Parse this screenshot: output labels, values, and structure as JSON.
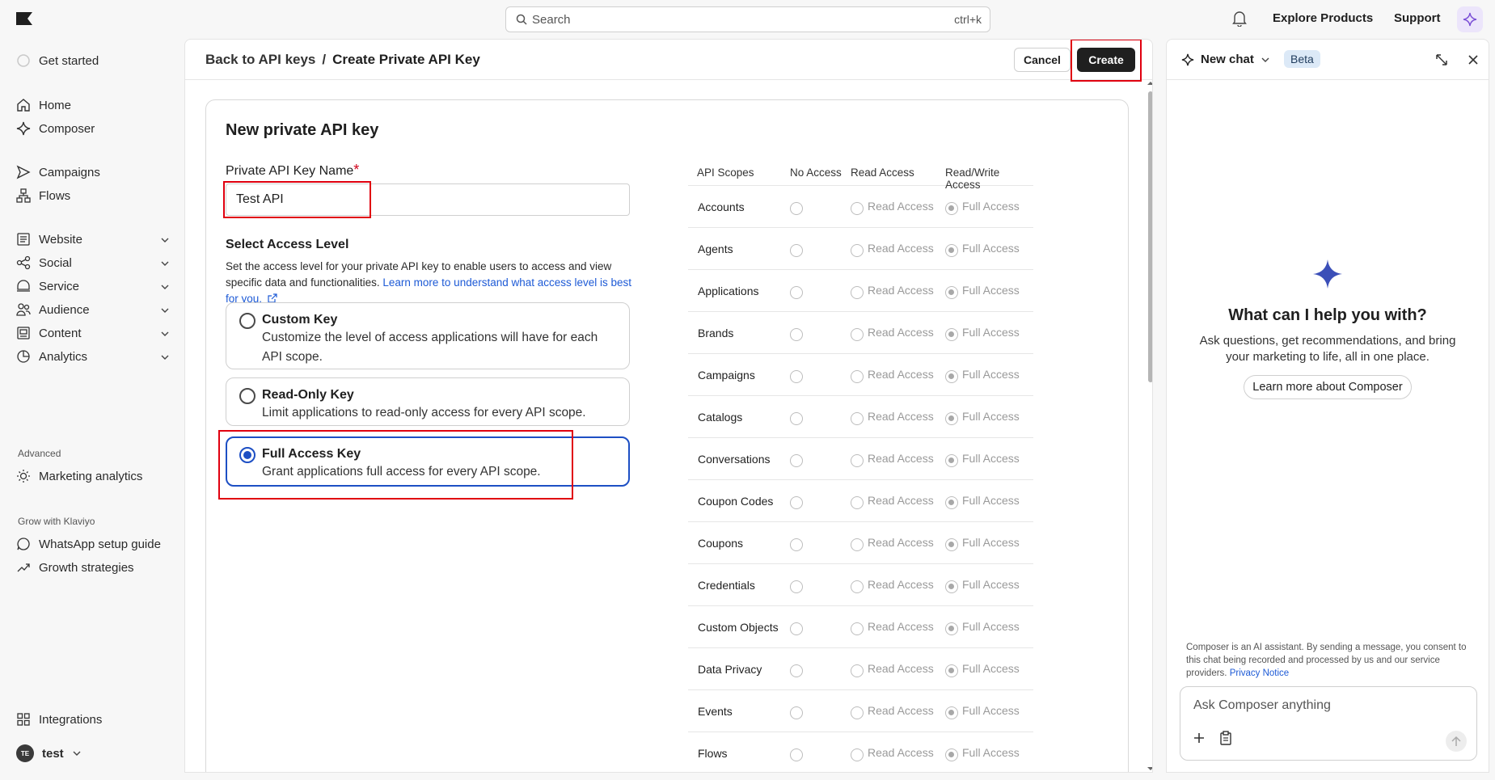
{
  "topbar": {
    "search_placeholder": "Search",
    "search_shortcut": "ctrl+k",
    "explore": "Explore Products",
    "support": "Support"
  },
  "sidebar": {
    "get_started": "Get started",
    "items": [
      {
        "label": "Home"
      },
      {
        "label": "Composer"
      },
      {
        "label": "Campaigns"
      },
      {
        "label": "Flows"
      },
      {
        "label": "Website"
      },
      {
        "label": "Social"
      },
      {
        "label": "Service"
      },
      {
        "label": "Audience"
      },
      {
        "label": "Content"
      },
      {
        "label": "Analytics"
      }
    ],
    "advanced_label": "Advanced",
    "marketing_analytics": "Marketing analytics",
    "grow_label": "Grow with Klaviyo",
    "whatsapp": "WhatsApp setup guide",
    "growth": "Growth strategies",
    "integrations": "Integrations",
    "account_initials": "TE",
    "account_name": "test"
  },
  "header": {
    "back": "Back to API keys",
    "separator": "/",
    "title": "Create Private API Key",
    "cancel": "Cancel",
    "create": "Create"
  },
  "form": {
    "title": "New private API key",
    "name_label": "Private API Key Name",
    "required_mark": "*",
    "name_value": "Test API",
    "access_title": "Select Access Level",
    "access_desc": "Set the access level for your private API key to enable users to access and view specific data and functionalities.",
    "learn_link": "Learn more to understand what access level is best for you.",
    "options": [
      {
        "title": "Custom Key",
        "desc": "Customize the level of access applications will have for each API scope."
      },
      {
        "title": "Read-Only Key",
        "desc": "Limit applications to read-only access for every API scope."
      },
      {
        "title": "Full Access Key",
        "desc": "Grant applications full access for every API scope."
      }
    ],
    "selected_option": "Full Access Key"
  },
  "scopes": {
    "headers": [
      "API Scopes",
      "No Access",
      "Read Access",
      "Read/Write Access"
    ],
    "read_label": "Read Access",
    "full_label": "Full Access",
    "rows": [
      "Accounts",
      "Agents",
      "Applications",
      "Brands",
      "Campaigns",
      "Catalogs",
      "Conversations",
      "Coupon Codes",
      "Coupons",
      "Credentials",
      "Custom Objects",
      "Data Privacy",
      "Events",
      "Flows"
    ]
  },
  "chat": {
    "new_chat": "New chat",
    "beta": "Beta",
    "question": "What can I help you with?",
    "subtitle": "Ask questions, get recommendations, and bring your marketing to life, all in one place.",
    "learn_more": "Learn more about Composer",
    "disclaimer": "Composer is an AI assistant. By sending a message, you consent to this chat being recorded and processed by us and our service providers.",
    "privacy": "Privacy Notice",
    "placeholder": "Ask Composer anything"
  },
  "colors": {
    "highlight": "#e0000f",
    "selected": "#1d4fc4",
    "link": "#1d5ad6",
    "create_bg": "#1f1f1f"
  }
}
